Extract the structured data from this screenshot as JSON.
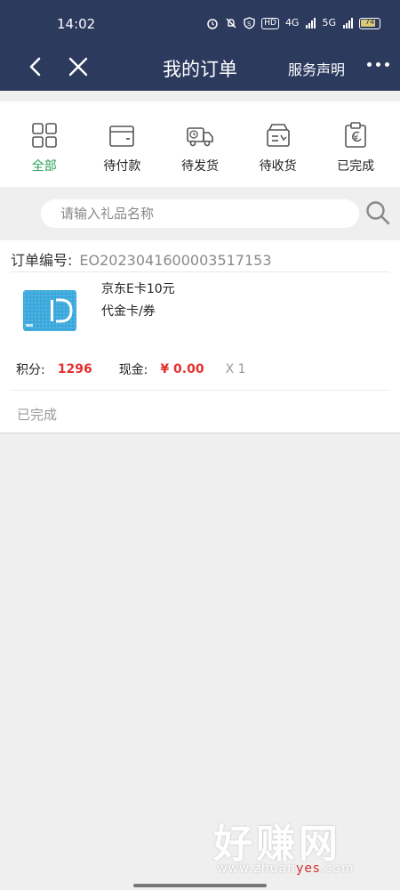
{
  "status_bar": {
    "time": "14:02",
    "hd_badge": "HD",
    "net_4g": "4G",
    "net_5g": "5G",
    "battery": "74"
  },
  "nav": {
    "title": "我的订单",
    "service_label": "服务声明",
    "back_icon": "chevron-left-icon",
    "close_icon": "close-icon",
    "more_icon": "more-horizontal-icon"
  },
  "tabs": [
    {
      "label": "全部",
      "icon": "grid-icon",
      "active": true
    },
    {
      "label": "待付款",
      "icon": "wallet-icon",
      "active": false
    },
    {
      "label": "待发货",
      "icon": "delivery-truck-icon",
      "active": false
    },
    {
      "label": "待收货",
      "icon": "package-receive-icon",
      "active": false
    },
    {
      "label": "已完成",
      "icon": "clipboard-yen-icon",
      "active": false
    }
  ],
  "search": {
    "placeholder": "请输入礼品名称"
  },
  "order": {
    "number_label": "订单编号:",
    "number_value": "EO2023041600003517153",
    "item_name": "京东E卡10元",
    "item_type": "代金卡/券",
    "points_label": "积分:",
    "points_value": "1296",
    "cash_label": "现金:",
    "cash_value": "¥ 0.00",
    "quantity": "X 1",
    "status": "已完成"
  },
  "watermark": {
    "logo_text": "好赚网",
    "url_pre": "www.zhuan",
    "url_hl": "yes",
    "url_post": ".com"
  },
  "colors": {
    "header_bg": "#2c3a5e",
    "active_tab": "#2aa15a",
    "price_red": "#e53030",
    "page_bg": "#efefef"
  }
}
